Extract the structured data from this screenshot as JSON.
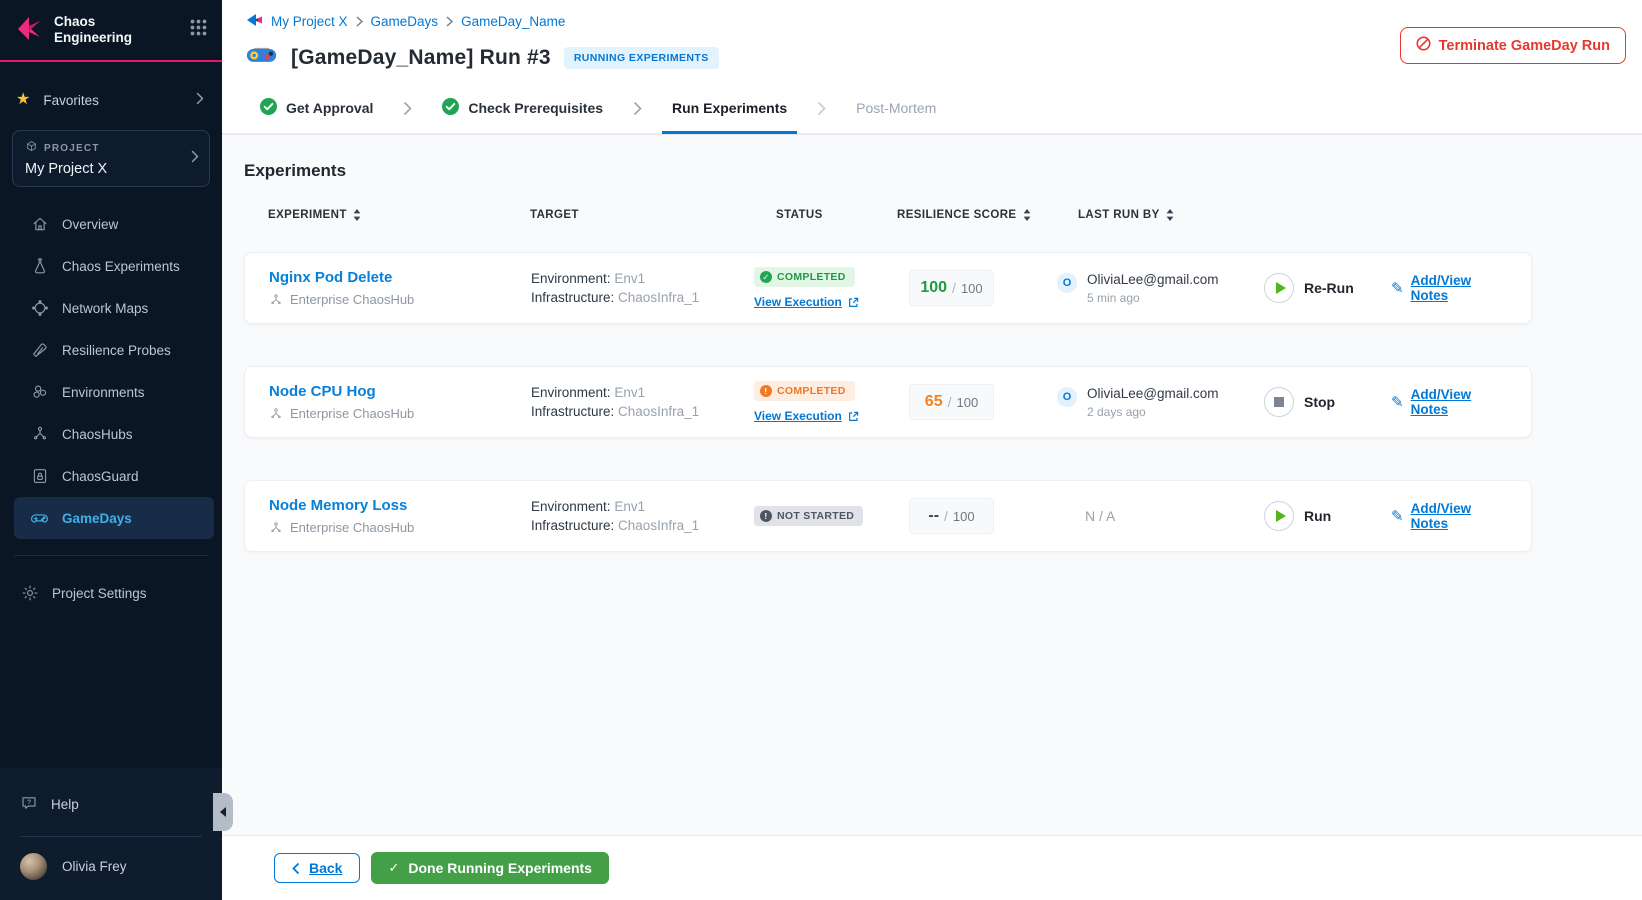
{
  "colors": {
    "accent_blue": "#0278d5",
    "brand_pink": "#e5186e",
    "success_green": "#21a453",
    "warning_orange": "#f07723",
    "danger_red": "#e5392e",
    "done_button_green": "#43a047",
    "active_nav_cyan": "#3eb1e8",
    "sidebar_bg": "#0a1623"
  },
  "icons": {
    "brand_logo": "pink chaos mark",
    "app_grid": "nine-dot app switcher",
    "favorites_star": "yellow star",
    "project_cube": "cube outline",
    "gameday_controller": "game controller",
    "terminate": "prohibition circle",
    "view_execution": "external link",
    "notes_pencil": "pencil",
    "run": "green play triangle",
    "stop": "gray square",
    "sort": "up-down triangles",
    "collapse": "left arrow handle"
  },
  "sidebar": {
    "brand": "Chaos Engineering",
    "favorites": "Favorites",
    "project_label": "PROJECT",
    "project_name": "My Project X",
    "nav": [
      {
        "label": "Overview"
      },
      {
        "label": "Chaos Experiments"
      },
      {
        "label": "Network Maps"
      },
      {
        "label": "Resilience Probes"
      },
      {
        "label": "Environments"
      },
      {
        "label": "ChaosHubs"
      },
      {
        "label": "ChaosGuard"
      },
      {
        "label": "GameDays"
      }
    ],
    "settings": "Project Settings",
    "help": "Help",
    "user": "Olivia Frey"
  },
  "header": {
    "breadcrumb": [
      "My Project X",
      "GameDays",
      "GameDay_Name"
    ],
    "title": "[GameDay_Name] Run #3",
    "badge": "RUNNING EXPERIMENTS",
    "terminate": "Terminate GameDay Run"
  },
  "stepper": [
    {
      "label": "Get Approval",
      "state": "done"
    },
    {
      "label": "Check Prerequisites",
      "state": "done"
    },
    {
      "label": "Run Experiments",
      "state": "active"
    },
    {
      "label": "Post-Mortem",
      "state": "upcoming"
    }
  ],
  "experiments": {
    "section_title": "Experiments",
    "columns": {
      "experiment": "EXPERIMENT",
      "target": "TARGET",
      "status": "STATUS",
      "score": "RESILIENCE SCORE",
      "last_run": "LAST RUN BY"
    },
    "rows": [
      {
        "name": "Nginx Pod Delete",
        "hub": "Enterprise ChaosHub",
        "env_label": "Environment:",
        "env": "Env1",
        "infra_label": "Infrastructure:",
        "infra": "ChaosInfra_1",
        "status": "COMPLETED",
        "view_execution": "View Execution",
        "score": "100",
        "score_sep": "/",
        "score_max": "100",
        "user_initial": "O",
        "user": "OliviaLee@gmail.com",
        "time": "5 min ago",
        "action": "Re-Run",
        "notes": "Add/View Notes"
      },
      {
        "name": "Node CPU Hog",
        "hub": "Enterprise ChaosHub",
        "env_label": "Environment:",
        "env": "Env1",
        "infra_label": "Infrastructure:",
        "infra": "ChaosInfra_1",
        "status": "COMPLETED",
        "view_execution": "View Execution",
        "score": "65",
        "score_sep": "/",
        "score_max": "100",
        "user_initial": "O",
        "user": "OliviaLee@gmail.com",
        "time": "2 days ago",
        "action": "Stop",
        "notes": "Add/View Notes"
      },
      {
        "name": "Node Memory Loss",
        "hub": "Enterprise ChaosHub",
        "env_label": "Environment:",
        "env": "Env1",
        "infra_label": "Infrastructure:",
        "infra": "ChaosInfra_1",
        "status": "NOT STARTED",
        "score": "--",
        "score_sep": "/",
        "score_max": "100",
        "na": "N / A",
        "action": "Run",
        "notes": "Add/View Notes"
      }
    ]
  },
  "footer": {
    "back": "Back",
    "done": "Done Running Experiments"
  }
}
